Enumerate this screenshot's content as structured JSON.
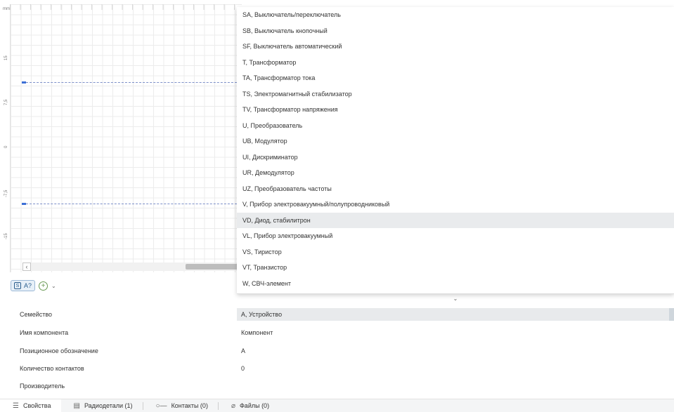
{
  "canvas": {
    "unit": "mm",
    "ticks": [
      "15",
      "7,5",
      "0",
      "-7,5",
      "-15"
    ]
  },
  "mini_toolbar": {
    "chip_label": "A?",
    "chip_icon": "S"
  },
  "dropdown": {
    "items": [
      "SA, Выключатель/переключатель",
      "SB, Выключатель кнопочный",
      "SF, Выключатель автоматический",
      "T, Трансформатор",
      "TA, Трансформатор тока",
      "TS, Электромагнитный стабилизатор",
      "TV, Трансформатор напряжения",
      "U, Преобразователь",
      "UB, Модулятор",
      "UI, Дискриминатор",
      "UR, Демодулятор",
      "UZ, Преобразователь частоты",
      "V, Прибор электровакуумный/полупроводниковый",
      "VD, Диод, стабилитрон",
      "VL, Прибор электровакуумный",
      "VS, Тиристор",
      "VT, Транзистор",
      "W, СВЧ-элемент"
    ],
    "highlighted_index": 13
  },
  "properties": {
    "family_label": "Семейство",
    "family_value": "A, Устройство",
    "name_label": "Имя компонента",
    "name_value": "Компонент",
    "designator_label": "Позиционное обозначение",
    "designator_value": "A",
    "contacts_label": "Количество контактов",
    "contacts_value": "0",
    "manufacturer_label": "Производитель"
  },
  "tabs": {
    "properties": "Свойства",
    "radio_parts": "Радиодетали (1)",
    "contacts": "Контакты (0)",
    "files": "Файлы (0)"
  }
}
